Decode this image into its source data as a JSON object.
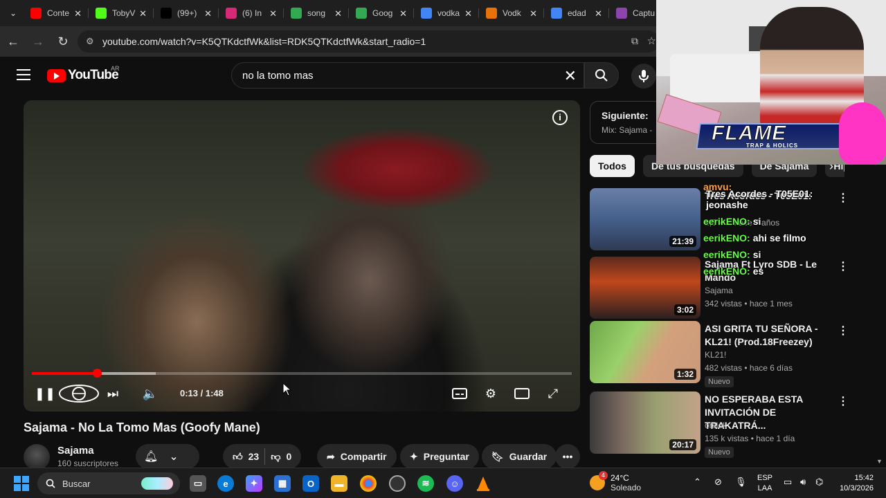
{
  "browser": {
    "tabs": [
      {
        "title": "Conte",
        "icon": "youtube-icon",
        "color": "#ff0000"
      },
      {
        "title": "TobyV",
        "icon": "kick-icon",
        "color": "#53fc18"
      },
      {
        "title": "(99+)",
        "icon": "tiktok-icon",
        "color": "#000000"
      },
      {
        "title": "(6) In",
        "icon": "instagram-icon",
        "color": "#d62976"
      },
      {
        "title": "song",
        "icon": "google-drive-icon",
        "color": "#34a853"
      },
      {
        "title": "Goog",
        "icon": "google-drive-icon",
        "color": "#34a853"
      },
      {
        "title": "vodka",
        "icon": "google-icon",
        "color": "#4285f4"
      },
      {
        "title": "Vodk",
        "icon": "generic-icon",
        "color": "#e8710a"
      },
      {
        "title": "edad",
        "icon": "google-icon",
        "color": "#4285f4"
      },
      {
        "title": "Captu",
        "icon": "pen-icon",
        "color": "#8e44ad"
      }
    ],
    "url": "youtube.com/watch?v=K5QTKdctfWk&list=RDK5QTKdctfWk&start_radio=1"
  },
  "youtube": {
    "logo_text": "YouTube",
    "country_code": "AR",
    "search_value": "no la tomo mas"
  },
  "player": {
    "time": "0:13 / 1:48",
    "progress_fraction": 0.12,
    "buffered_fraction": 0.23
  },
  "video": {
    "title": "Sajama - No La Tomo Mas (Goofy Mane)",
    "channel": "Sajama",
    "subscribers": "160 suscriptores",
    "likes": "23",
    "dislikes": "0",
    "share_label": "Compartir",
    "ask_label": "Preguntar",
    "save_label": "Guardar"
  },
  "playlist": {
    "next_label": "Siguiente:",
    "mix_label": "Mix: Sajama -"
  },
  "chips": [
    "Todos",
    "De tus búsquedas",
    "De Sajama",
    "Hip"
  ],
  "recommendations": [
    {
      "title": "Tres Acordes - T05E01:",
      "channel": "",
      "meta": "1,5 k ... hace 7 años",
      "duration": "21:39",
      "badge": "",
      "thumb": "linear-gradient(180deg,#6a7fa8 0%,#44608a 50%,#2f3a55 100%)"
    },
    {
      "title": "Sajama Ft Lyro SDB - Le Mando",
      "channel": "Sajama",
      "meta": "342 vistas • hace 1 mes",
      "duration": "3:02",
      "badge": "",
      "thumb": "linear-gradient(180deg,#5a2a1e 0%,#c0471c 40%,#2a2020 100%)"
    },
    {
      "title": "ASI GRITA TU SEÑORA - KL21! (Prod.18Freezey)",
      "channel": "KL21!",
      "meta": "482 vistas • hace 6 días",
      "duration": "1:32",
      "badge": "Nuevo",
      "thumb": "linear-gradient(120deg,#6fa84a 0%,#9ad06a 35%,#d4a07c 60%,#c89a7a 100%)"
    },
    {
      "title": "NO ESPERABA ESTA INVITACIÓN DE TRAKATRÁ...",
      "channel": "orslok",
      "meta": "135 k vistas • hace 1 día",
      "duration": "20:17",
      "badge": "Nuevo",
      "thumb": "linear-gradient(90deg,#3a3a3a 0%,#7b6a60 30%,#9aa070 60%,#c2a28a 100%)"
    }
  ],
  "overlay": {
    "banner": "FLAME",
    "banner_sub": "TRAP & HOLICS",
    "chat": [
      {
        "user": "amvu:",
        "msg": "",
        "user_color": "#ffa040"
      },
      {
        "user": "",
        "msg": "Tres Acordes - T05E01:",
        "user_color": "#66ff44"
      },
      {
        "user": "",
        "msg": "jeonashe",
        "user_color": "#66ff44"
      },
      {
        "user": "eerikENO:",
        "msg": "si",
        "user_color": "#66ff44"
      },
      {
        "user": "eerikENO:",
        "msg": "ahi se filmo",
        "user_color": "#66ff44"
      },
      {
        "user": "eerikENO:",
        "msg": "si",
        "user_color": "#66ff44"
      },
      {
        "user": "eerikENO:",
        "msg": "es",
        "user_color": "#66ff44"
      }
    ]
  },
  "taskbar": {
    "search_placeholder": "Buscar",
    "weather_badge": "4",
    "temperature": "24°C",
    "condition": "Soleado",
    "lang_1": "ESP",
    "lang_2": "LAA",
    "time": "15:42",
    "date": "10/3/2026"
  }
}
